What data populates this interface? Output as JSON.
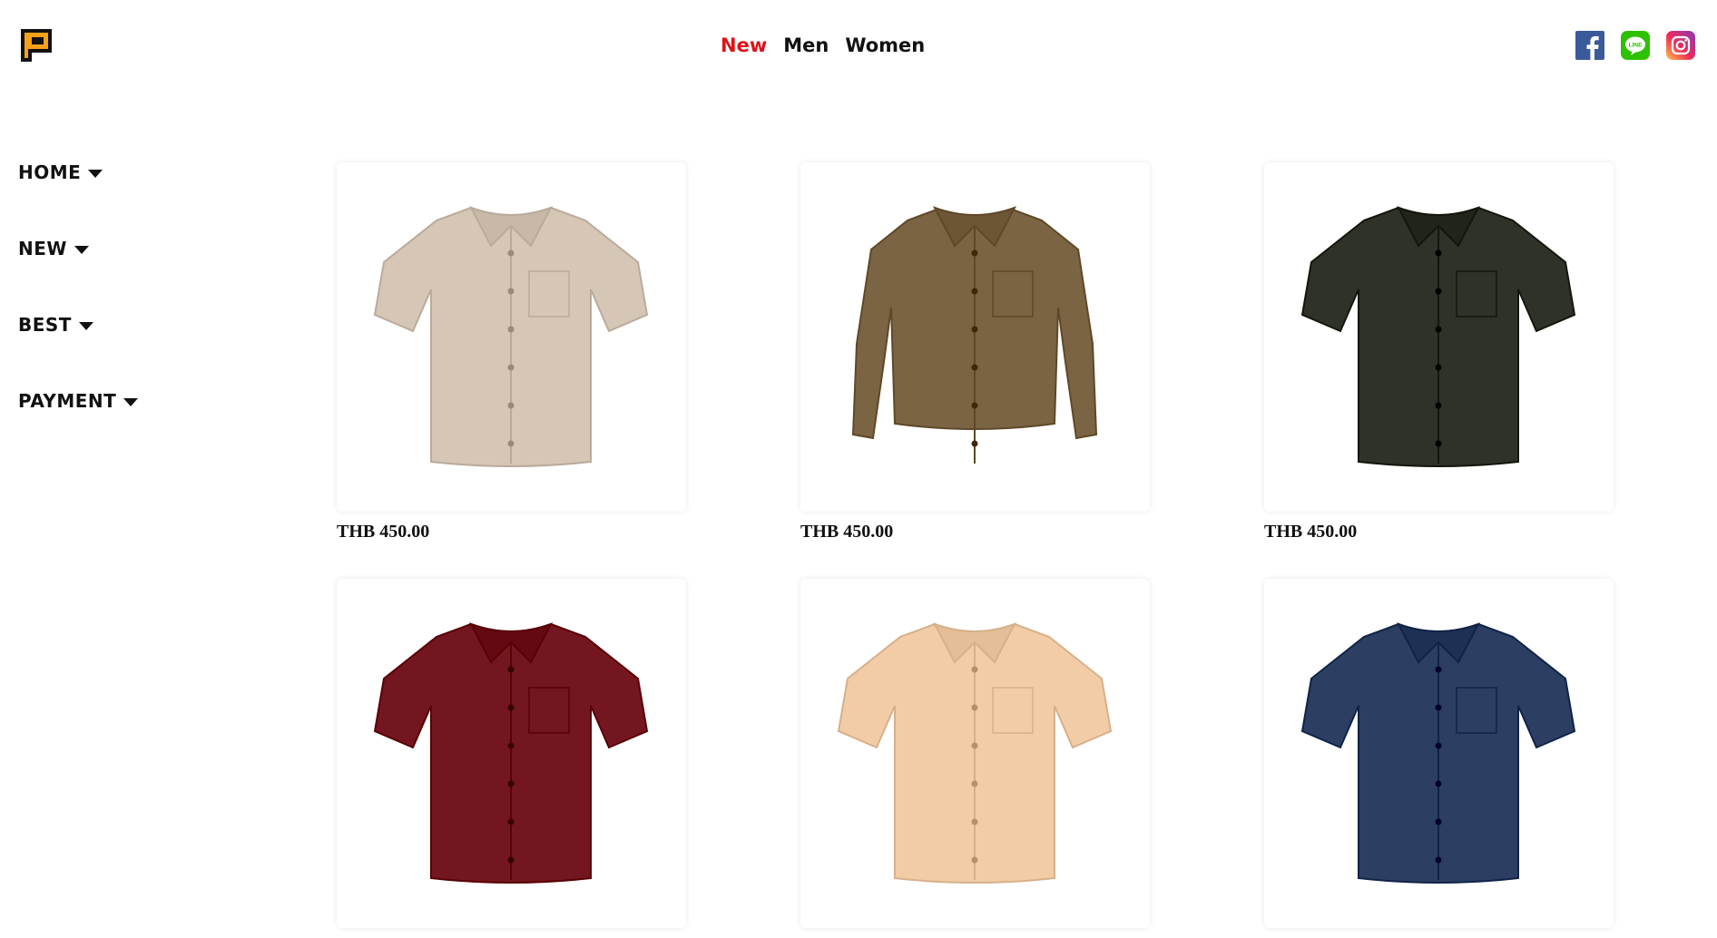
{
  "header": {
    "nav": [
      {
        "label": "New",
        "active": true
      },
      {
        "label": "Men",
        "active": false
      },
      {
        "label": "Women",
        "active": false
      }
    ],
    "social": [
      "facebook-icon",
      "line-icon",
      "instagram-icon"
    ],
    "line_label": "LINE"
  },
  "sidebar": {
    "items": [
      {
        "label": "HOME"
      },
      {
        "label": "NEW"
      },
      {
        "label": "BEST"
      },
      {
        "label": "PAYMENT"
      }
    ]
  },
  "products": [
    {
      "price": "THB 450.00",
      "color": "#d6c6b6",
      "style": "short"
    },
    {
      "price": "THB 450.00",
      "color": "#7b6444",
      "style": "long"
    },
    {
      "price": "THB 450.00",
      "color": "#2f3229",
      "style": "short"
    },
    {
      "price": "",
      "color": "#74161f",
      "style": "short"
    },
    {
      "price": "",
      "color": "#f2cca6",
      "style": "short"
    },
    {
      "price": "",
      "color": "#2c3f63",
      "style": "short"
    }
  ],
  "colors": {
    "accent": "#e0121a",
    "logo_orange": "#f5a01a",
    "facebook": "#3b5a9a",
    "line": "#2ec100"
  }
}
